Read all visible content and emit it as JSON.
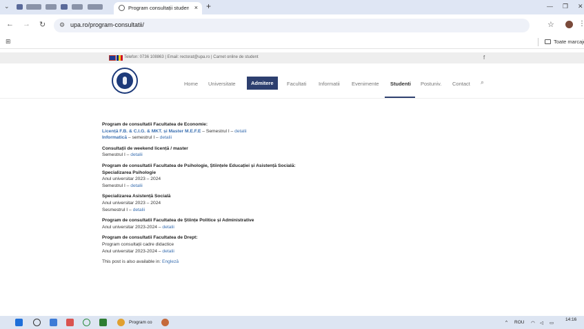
{
  "browser": {
    "tab_title": "Program consultații studenți - ",
    "tab_close": "×",
    "new_tab": "+",
    "url": "upa.ro/program-consultatii/",
    "bookmarks_folder": "Toate marcajele",
    "icons": [
      "menu-icon",
      "back-icon",
      "forward-icon",
      "reload-icon",
      "site-settings-icon",
      "star-icon",
      "kebab-icon",
      "apps-icon",
      "folder-icon"
    ]
  },
  "site": {
    "topbar_text": "Telefon: 0736 108863 | Email: rectorat@upa.ro | Carnet online de student",
    "facebook_icon": "f",
    "menu": [
      "Home",
      "Universitate",
      "Admitere",
      "Facultati",
      "Informatii",
      "Evenimente",
      "Studenti",
      "Postuniv.",
      "Contact"
    ],
    "active_menu": "Admitere",
    "current_menu": "Studenti",
    "accent_color": "#2d3f6f",
    "link_color": "#3a6fb0"
  },
  "content": {
    "economie_title": "Program de consultatii Facultatea de Economie:",
    "economie_line1_link": "Licență F.B. & C.I.G. & MKT. și Master M.E.F.E",
    "economie_line1_rest": " – Semestrul I – ",
    "economie_line2_link": "Informatică",
    "economie_line2_rest": " – semestrul I – ",
    "weekend_title": "Consultații de weekend licență / master",
    "weekend_line": "Semestrul I – ",
    "psiho_title": "Program de consultatii Facultatea de Psihologie, Științele Educației și Asistență Socială:",
    "psiho_spec": "Specializarea Psihologie",
    "psiho_year": "Anul universitar 2023 – 2024",
    "psiho_sem": "Semestrul  I – ",
    "as_spec": "Specializarea Asistență Socială",
    "as_year": "Anul universitar 2023 – 2024",
    "as_sem": "Sesmestrul I – ",
    "sp_title": "Program de consultatii Facultatea de Științe Politice și Administrative",
    "sp_year": "Anul universitar 2023-2024 – ",
    "drept_title": "Program de consultatii Facultatea de Drept:",
    "drept_line1": "Program consultații cadre didactice",
    "drept_year": "Anul universitar 2023-2024 – ",
    "detalii": "detalii",
    "available_text": "This post is also available in: ",
    "available_link": "Engleză"
  },
  "taskbar": {
    "app_label": "Program co",
    "lang": "ROU",
    "time": "14:16"
  }
}
